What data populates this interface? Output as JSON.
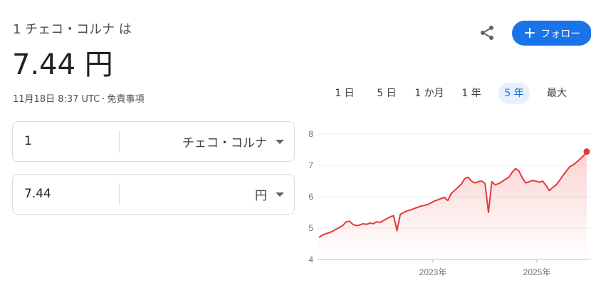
{
  "header": {
    "subtitle": "1 チェコ・コルナ は",
    "rate": "7.44 円",
    "timestamp": "11月18日 8:37 UTC",
    "separator": "·",
    "disclaimer": "免責事項"
  },
  "actions": {
    "share_icon": "share-icon",
    "follow_label": "フォロー",
    "follow_icon": "plus-icon",
    "accent": "#1a73e8"
  },
  "converter": {
    "from": {
      "amount": "1",
      "currency": "チェコ・コルナ"
    },
    "to": {
      "amount": "7.44",
      "currency": "円"
    }
  },
  "ranges": {
    "items": [
      {
        "label": "1 日",
        "active": false
      },
      {
        "label": "5 日",
        "active": false
      },
      {
        "label": "1 か月",
        "active": false
      },
      {
        "label": "1 年",
        "active": false
      },
      {
        "label": "5 年",
        "active": true
      },
      {
        "label": "最大",
        "active": false
      }
    ]
  },
  "chart_data": {
    "type": "line",
    "title": "",
    "xlabel": "",
    "ylabel": "",
    "ylim": [
      4,
      8
    ],
    "y_ticks": [
      "4",
      "5",
      "6",
      "7",
      "8"
    ],
    "x_tick_labels": [
      "2023年",
      "2025年"
    ],
    "grid": true,
    "line_color": "#e53935",
    "series": [
      {
        "values": [
          4.7,
          4.78,
          4.82,
          4.85,
          4.9,
          4.96,
          5.02,
          5.08,
          5.2,
          5.22,
          5.12,
          5.08,
          5.1,
          5.14,
          5.12,
          5.16,
          5.14,
          5.2,
          5.18,
          5.24,
          5.3,
          5.36,
          5.4,
          4.92,
          5.44,
          5.5,
          5.55,
          5.58,
          5.62,
          5.66,
          5.7,
          5.72,
          5.75,
          5.8,
          5.86,
          5.9,
          5.94,
          5.98,
          5.88,
          6.1,
          6.2,
          6.3,
          6.4,
          6.58,
          6.62,
          6.5,
          6.44,
          6.48,
          6.5,
          6.42,
          5.5,
          6.48,
          6.38,
          6.42,
          6.48,
          6.56,
          6.62,
          6.78,
          6.9,
          6.82,
          6.6,
          6.44,
          6.48,
          6.52,
          6.5,
          6.46,
          6.5,
          6.36,
          6.2,
          6.3,
          6.38,
          6.52,
          6.68,
          6.82,
          6.96,
          7.02,
          7.1,
          7.2,
          7.3,
          7.44
        ]
      }
    ]
  }
}
